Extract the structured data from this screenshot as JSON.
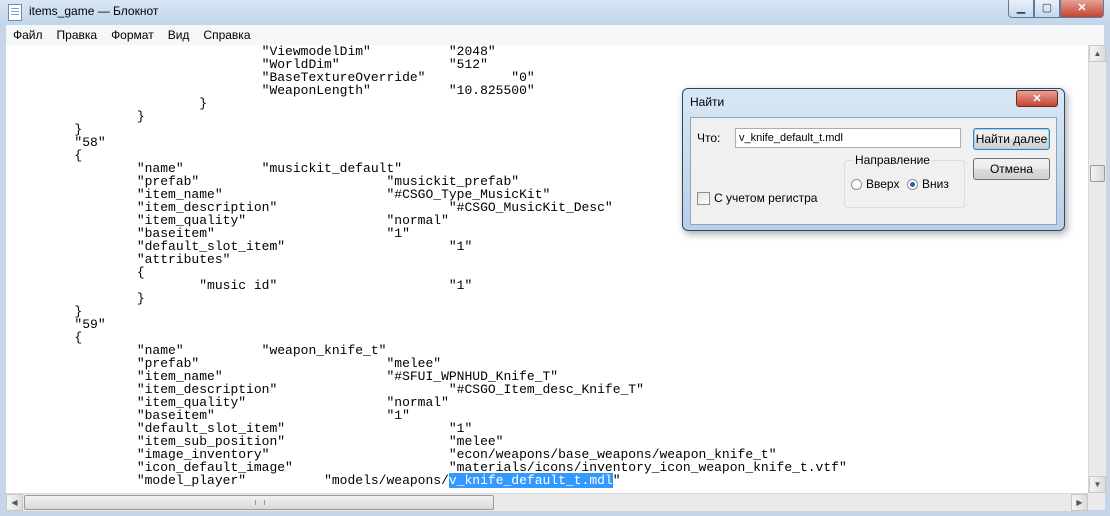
{
  "window": {
    "title": "items_game — Блокнот",
    "minimize_glyph": "▁",
    "maximize_glyph": "▢",
    "close_glyph": "✕"
  },
  "menu": [
    "Файл",
    "Правка",
    "Формат",
    "Вид",
    "Справка"
  ],
  "editor": {
    "text_before_selection": "\t\t\t\t\"ViewmodelDim\"\t\t\"2048\"\n\t\t\t\t\"WorldDim\"\t\t\"512\"\n\t\t\t\t\"BaseTextureOverride\"\t\t\"0\"\n\t\t\t\t\"WeaponLength\"\t\t\"10.825500\"\n\t\t\t}\n\t\t}\n\t}\n\t\"58\"\n\t{\n\t\t\"name\"\t\t\"musickit_default\"\n\t\t\"prefab\"\t\t\t\"musickit_prefab\"\n\t\t\"item_name\"\t\t\t\"#CSGO_Type_MusicKit\"\n\t\t\"item_description\"\t\t\t\"#CSGO_MusicKit_Desc\"\n\t\t\"item_quality\"\t\t\t\"normal\"\n\t\t\"baseitem\"\t\t\t\"1\"\n\t\t\"default_slot_item\"\t\t\t\"1\"\n\t\t\"attributes\"\n\t\t{\n\t\t\t\"music id\"\t\t\t\"1\"\n\t\t}\n\t}\n\t\"59\"\n\t{\n\t\t\"name\"\t\t\"weapon_knife_t\"\n\t\t\"prefab\"\t\t\t\"melee\"\n\t\t\"item_name\"\t\t\t\"#SFUI_WPNHUD_Knife_T\"\n\t\t\"item_description\"\t\t\t\"#CSGO_Item_desc_Knife_T\"\n\t\t\"item_quality\"\t\t\t\"normal\"\n\t\t\"baseitem\"\t\t\t\"1\"\n\t\t\"default_slot_item\"\t\t\t\"1\"\n\t\t\"item_sub_position\"\t\t\t\"melee\"\n\t\t\"image_inventory\"\t\t\t\"econ/weapons/base_weapons/weapon_knife_t\"\n\t\t\"icon_default_image\"\t\t\t\"materials/icons/inventory_icon_weapon_knife_t.vtf\"\n\t\t\"model_player\"\t\t\"models/weapons/",
    "selected_text": "v_knife_default_t.mdl",
    "text_after_selection": "\""
  },
  "find_dialog": {
    "title": "Найти",
    "close_glyph": "✕",
    "what_label": "Что:",
    "search_value": "v_knife_default_t.mdl",
    "find_next_label": "Найти далее",
    "cancel_label": "Отмена",
    "match_case_label": "С учетом регистра",
    "direction_title": "Направление",
    "up_label": "Вверх",
    "down_label": "Вниз",
    "direction_selected": "Вниз"
  }
}
